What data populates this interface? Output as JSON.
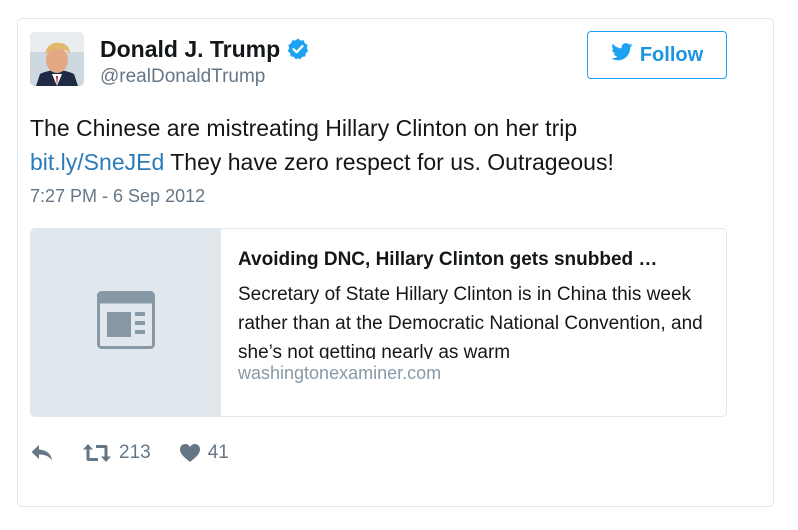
{
  "author": {
    "name": "Donald J. Trump",
    "handle": "@realDonaldTrump",
    "verified": true
  },
  "follow_button": {
    "label": "Follow",
    "icon": "twitter-bird-icon"
  },
  "tweet": {
    "text_line1": "The Chinese are mistreating Hillary Clinton on her trip",
    "link_text": "bit.ly/SneJEd",
    "text_line2_rest": " They have zero respect for us. Outrageous!",
    "timestamp": "7:27 PM - 6 Sep 2012"
  },
  "card": {
    "thumbnail_icon": "article-icon",
    "title": "Avoiding DNC, Hillary Clinton gets snubbed …",
    "description": "Secretary of State Hillary Clinton is in China this week rather than at the Democratic National Convention, and she’s not getting nearly as warm",
    "domain": "washingtonexaminer.com"
  },
  "actions": {
    "reply_icon": "reply-icon",
    "retweet_icon": "retweet-icon",
    "retweet_count": "213",
    "like_icon": "heart-icon",
    "like_count": "41"
  },
  "colors": {
    "accent": "#1da1f2",
    "link": "#2b7bb9",
    "secondary_text": "#657786",
    "border": "#e1e8ed"
  }
}
